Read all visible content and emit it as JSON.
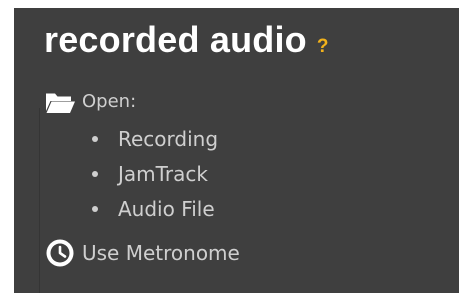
{
  "panel": {
    "title": "recorded audio",
    "help_symbol": "?",
    "open_label": "Open:",
    "open_items": [
      {
        "label": "Recording"
      },
      {
        "label": "JamTrack"
      },
      {
        "label": "Audio File"
      }
    ],
    "metronome_label": "Use Metronome"
  },
  "icons": {
    "open": "folder-icon",
    "metronome": "clock-icon"
  },
  "colors": {
    "panel_background": "#3f3f3f",
    "title_text": "#ffffff",
    "help_accent": "#f2b21b",
    "body_text": "#cfcfcf"
  }
}
